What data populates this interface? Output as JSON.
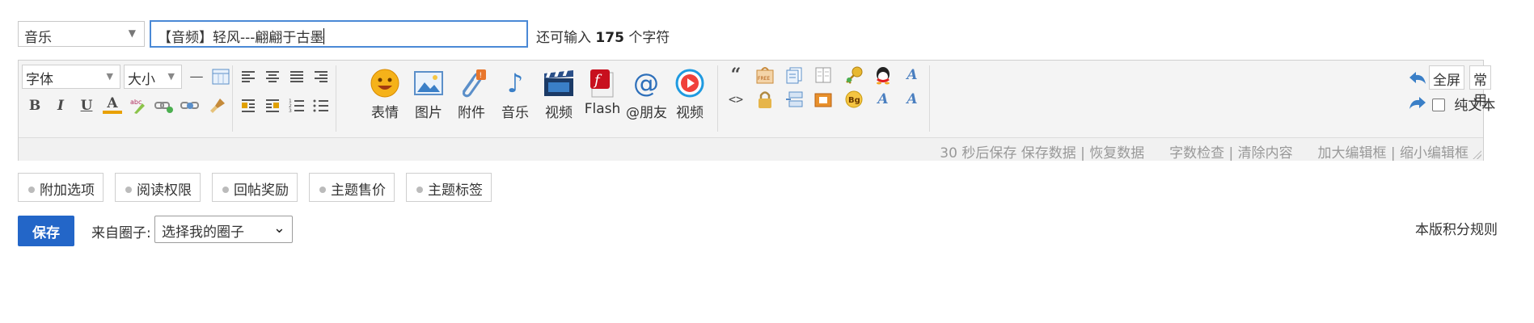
{
  "post": {
    "type_select": "音乐",
    "title_value": "【音频】轻风---翩翩于古墨",
    "remain_prefix": "还可输入",
    "remain_count": "175",
    "remain_suffix": "个字符"
  },
  "toolbar": {
    "font_label": "字体",
    "size_label": "大小",
    "big_buttons": [
      "表情",
      "图片",
      "附件",
      "音乐",
      "视频",
      "Flash",
      "@朋友",
      "视频"
    ],
    "fullscreen": "全屏",
    "common": "常用",
    "plain_text": "纯文本",
    "small_glyphs": {
      "bold": "B",
      "italic": "I",
      "underline": "U",
      "color": "A",
      "quote": "“",
      "code": "<>",
      "font_a": "A",
      "free": "FREE",
      "bg": "Bg",
      "hr": "—"
    }
  },
  "statusbar": {
    "autosave": "30 秒后保存",
    "save_data": "保存数据",
    "restore_data": "恢复数据",
    "check_len": "字数检查",
    "clear": "清除内容",
    "enlarge": "加大编辑框",
    "shrink": "缩小编辑框",
    "sep": "|"
  },
  "options": {
    "tabs": [
      "附加选项",
      "阅读权限",
      "回帖奖励",
      "主题售价",
      "主题标签"
    ]
  },
  "footer": {
    "save_label": "保存",
    "circle_label": "来自圈子:",
    "circle_select": "选择我的圈子",
    "rules_link": "本版积分规则"
  },
  "colors": {
    "accent": "#2366c8",
    "input_border": "#4a89d6",
    "toolbar_bg": "#f4f4f4",
    "muted_text": "#999999"
  }
}
